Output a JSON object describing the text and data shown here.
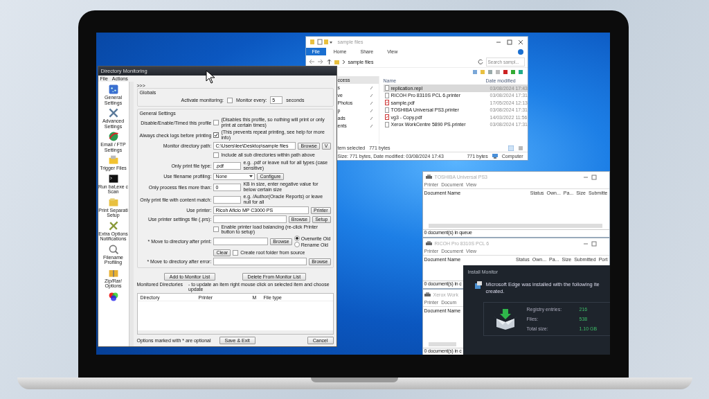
{
  "directory_monitoring": {
    "title": "Directory Monitoring",
    "menu": [
      "File",
      "Actions"
    ],
    "sidebar": [
      {
        "label": "General Settings"
      },
      {
        "label": "Advanced Settings"
      },
      {
        "label": "Email / FTP Settings"
      },
      {
        "label": "Trigger Files"
      },
      {
        "label": "Run bat,exe c Scan"
      },
      {
        "label": "Print Separati Setup"
      },
      {
        "label": "Extra Options Notifications"
      },
      {
        "label": "Filename Profiling"
      },
      {
        "label": "Zip/Rar/ Options"
      }
    ],
    "collapse": ">>>",
    "globals": {
      "title": "Globals",
      "activate_label": "Activate monitoring:",
      "activate_checked": false,
      "interval_label": "Monitor every:",
      "interval_value": "5",
      "interval_unit": "seconds"
    },
    "general": {
      "title": "General Settings",
      "rows": [
        {
          "kind": "checkbox",
          "label": "Disable/Enable/Timed this profile",
          "checked": false,
          "note": "(Disables this profile, so nothing will print or only print at certain times)"
        },
        {
          "kind": "checkbox",
          "label": "Always check logs before printing",
          "checked": true,
          "note": "(This prevents repeat printing, see help for more info)"
        },
        {
          "kind": "text",
          "label": "Monitor directory path:",
          "value": "C:\\Users\\lee\\Desktop\\sample files",
          "buttons": [
            "Browse",
            "V"
          ]
        },
        {
          "kind": "subcheck",
          "checked": false,
          "text": "Include all sub directories within path above"
        },
        {
          "kind": "text",
          "label": "Only print file type:",
          "value": ".pdf",
          "note": "e.g. .pdf or leave null for all types (case sensitive)"
        },
        {
          "kind": "select",
          "label": "Use filename profiling:",
          "value": "None",
          "buttons": [
            "Configure"
          ]
        },
        {
          "kind": "text",
          "label": "Only process files more than:",
          "value": "0",
          "note": "KB in size, enter negative value for below certain size"
        },
        {
          "kind": "text",
          "label": "Only print file with content match:",
          "value": "",
          "note": "e.g. /Author(Oracle Reports) or leave null for all"
        },
        {
          "kind": "text",
          "label": "Use printer:",
          "value": "Ricoh Aficio MP C3000 PS",
          "buttons": [
            "Printer"
          ]
        },
        {
          "kind": "text",
          "label": "Use printer settings file (.prs):",
          "value": "",
          "buttons": [
            "Browse",
            "Setup"
          ]
        },
        {
          "kind": "subcheck",
          "checked": false,
          "text": "Enable printer load balancing (re-click Printer button to setup)"
        },
        {
          "kind": "text",
          "label": "* Move to directory after print:",
          "value": "",
          "buttons": [
            "Browse"
          ],
          "radios": [
            {
              "label": "Overwrite Old",
              "selected": true
            },
            {
              "label": "Rename Old",
              "selected": false
            }
          ]
        },
        {
          "kind": "clear",
          "button": "Clear",
          "checked": false,
          "text": "Create root folder from source"
        },
        {
          "kind": "text",
          "label": "* Move to directory after error:",
          "value": "",
          "buttons": [
            "Browse"
          ]
        }
      ]
    },
    "list_buttons": [
      "Add to Monitor List",
      "Delete From Monitor List"
    ],
    "monitored": {
      "title": "Monitored Directories",
      "hint": "- to update an item right mouse click on selected item and choose update",
      "columns": [
        "Directory",
        "Printer",
        "M",
        "File type"
      ]
    },
    "footer": {
      "note": "Options marked with * are optional",
      "buttons": [
        "Save & Exit",
        "Cancel"
      ]
    }
  },
  "explorer": {
    "title": "sample files",
    "ribbon_tabs": [
      {
        "label": "File",
        "selected": true
      },
      {
        "label": "Home",
        "selected": false
      },
      {
        "label": "Share",
        "selected": false
      },
      {
        "label": "View",
        "selected": false
      }
    ],
    "path": "sample files",
    "search_placeholder": "Search sampl...",
    "nav": [
      "ccess",
      "s",
      "ve",
      "Photos",
      "p",
      "ads",
      "ents"
    ],
    "columns": [
      "Name",
      "Date modified"
    ],
    "files": [
      {
        "name": "replication.repl",
        "date": "03/08/2024 17:43",
        "kind": "file",
        "selected": true
      },
      {
        "name": "RICOH Pro 8310S PCL 6.printer",
        "date": "03/08/2024 17:31",
        "kind": "file",
        "selected": false
      },
      {
        "name": "sample.pdf",
        "date": "17/05/2024 12:13",
        "kind": "pdf",
        "selected": false
      },
      {
        "name": "TOSHIBA Universal PS3.printer",
        "date": "03/08/2024 17:31",
        "kind": "file",
        "selected": false
      },
      {
        "name": "vg3 - Copy.pdf",
        "date": "14/03/2022 11:56",
        "kind": "pdf",
        "selected": false
      },
      {
        "name": "Xerox WorkCentre 5890 PS.printer",
        "date": "03/08/2024 17:31",
        "kind": "file",
        "selected": false
      }
    ],
    "status": [
      "tem selected",
      "771 bytes"
    ],
    "details": [
      "Size: 771 bytes, Date modified: 03/08/2024 17:43",
      "771 bytes",
      "Computer"
    ]
  },
  "print_queues": [
    {
      "title": "TOSHIBA Universal PS3",
      "menu": [
        "Printer",
        "Document",
        "View"
      ],
      "columns": [
        "Document Name",
        "Status",
        "Own...",
        "Pa...",
        "Size",
        "Submitte"
      ],
      "status": "0 document(s) in queue"
    },
    {
      "title": "RICOH Pro 8310S PCL 6",
      "menu": [
        "Printer",
        "Document",
        "View"
      ],
      "columns": [
        "Document Name",
        "Status",
        "Own...",
        "Pa...",
        "Size",
        "Submitted",
        "Port"
      ],
      "status": "0 document(s) in c"
    },
    {
      "title": "Xerox Work",
      "menu": [
        "Printer",
        "Docum"
      ],
      "columns": [
        "Document Name"
      ],
      "status": "0 document(s) in c"
    }
  ],
  "install_monitor": {
    "title": "Install Monitor",
    "message_lines": [
      "Microsoft Edge was installed with the following ite",
      "created."
    ],
    "stats": [
      {
        "label": "Registry entries:",
        "value": "216"
      },
      {
        "label": "Files:",
        "value": "538"
      },
      {
        "label": "Total size:",
        "value": "1.10 GB"
      }
    ]
  }
}
